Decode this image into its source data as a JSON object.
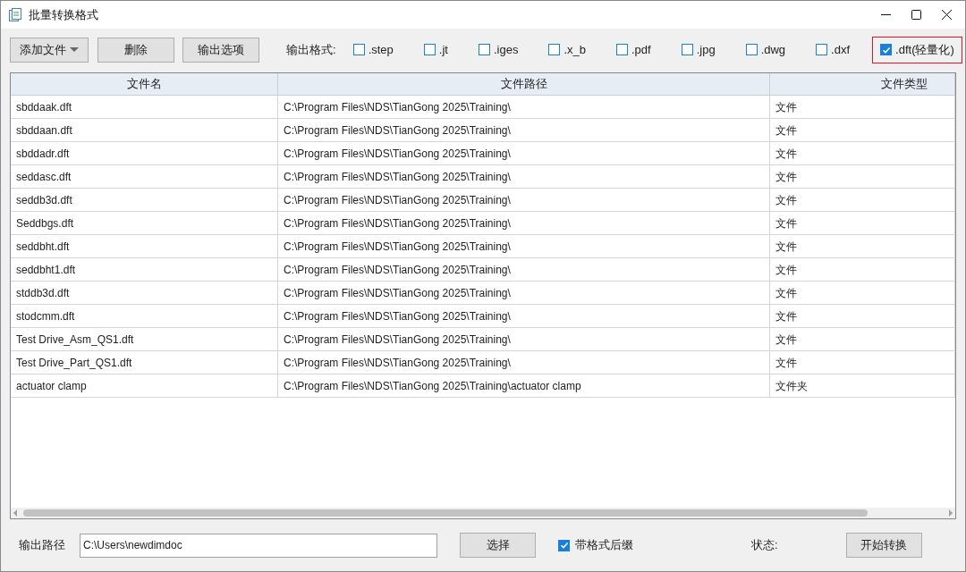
{
  "window": {
    "title": "批量转换格式"
  },
  "toolbar": {
    "buttons": [
      {
        "label": "添加文件",
        "kind": "dropdown"
      },
      {
        "label": "删除",
        "kind": "plain"
      },
      {
        "label": "输出选项",
        "kind": "plain"
      }
    ],
    "format_label": "输出格式:"
  },
  "formats": [
    {
      "label": ".step",
      "checked": false,
      "highlighted": false
    },
    {
      "label": ".jt",
      "checked": false,
      "highlighted": false
    },
    {
      "label": ".iges",
      "checked": false,
      "highlighted": false
    },
    {
      "label": ".x_b",
      "checked": false,
      "highlighted": false
    },
    {
      "label": ".pdf",
      "checked": false,
      "highlighted": false
    },
    {
      "label": ".jpg",
      "checked": false,
      "highlighted": false
    },
    {
      "label": ".dwg",
      "checked": false,
      "highlighted": false
    },
    {
      "label": ".dxf",
      "checked": false,
      "highlighted": false
    },
    {
      "label": ".dft(轻量化)",
      "checked": true,
      "highlighted": true
    }
  ],
  "table": {
    "columns": [
      "文件名",
      "文件路径",
      "文件类型"
    ],
    "rows": [
      [
        "sbddaak.dft",
        "C:\\Program Files\\NDS\\TianGong 2025\\Training\\",
        "文件"
      ],
      [
        "sbddaan.dft",
        "C:\\Program Files\\NDS\\TianGong 2025\\Training\\",
        "文件"
      ],
      [
        "sbddadr.dft",
        "C:\\Program Files\\NDS\\TianGong 2025\\Training\\",
        "文件"
      ],
      [
        "seddasc.dft",
        "C:\\Program Files\\NDS\\TianGong 2025\\Training\\",
        "文件"
      ],
      [
        "seddb3d.dft",
        "C:\\Program Files\\NDS\\TianGong 2025\\Training\\",
        "文件"
      ],
      [
        "Seddbgs.dft",
        "C:\\Program Files\\NDS\\TianGong 2025\\Training\\",
        "文件"
      ],
      [
        "seddbht.dft",
        "C:\\Program Files\\NDS\\TianGong 2025\\Training\\",
        "文件"
      ],
      [
        "seddbht1.dft",
        "C:\\Program Files\\NDS\\TianGong 2025\\Training\\",
        "文件"
      ],
      [
        "stddb3d.dft",
        "C:\\Program Files\\NDS\\TianGong 2025\\Training\\",
        "文件"
      ],
      [
        "stodcmm.dft",
        "C:\\Program Files\\NDS\\TianGong 2025\\Training\\",
        "文件"
      ],
      [
        "Test Drive_Asm_QS1.dft",
        "C:\\Program Files\\NDS\\TianGong 2025\\Training\\",
        "文件"
      ],
      [
        "Test Drive_Part_QS1.dft",
        "C:\\Program Files\\NDS\\TianGong 2025\\Training\\",
        "文件"
      ],
      [
        "actuator clamp",
        "C:\\Program Files\\NDS\\TianGong 2025\\Training\\actuator clamp",
        "文件夹"
      ]
    ]
  },
  "footer": {
    "path_label": "输出路径",
    "path_value": "C:\\Users\\newdimdoc",
    "choose_button": "选择",
    "suffix": {
      "label": "带格式后缀",
      "checked": true
    },
    "status_label": "状态:",
    "start_button": "开始转换"
  }
}
